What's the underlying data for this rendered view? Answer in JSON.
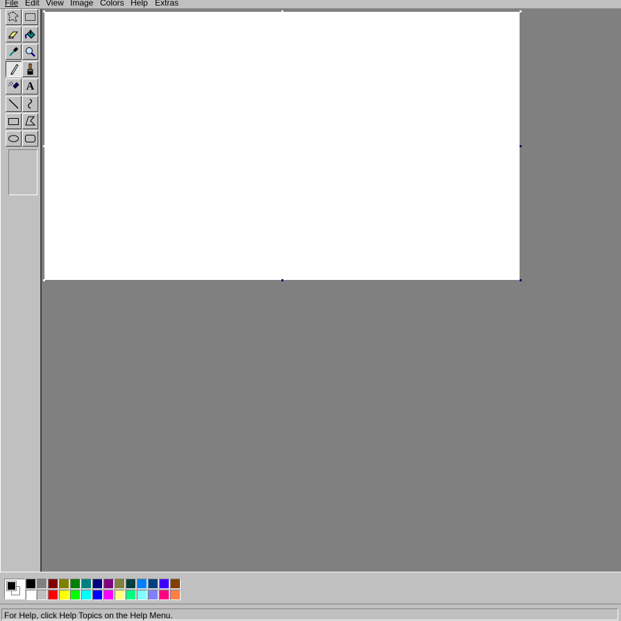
{
  "menu": {
    "items": [
      {
        "label": "File"
      },
      {
        "label": "Edit"
      },
      {
        "label": "View"
      },
      {
        "label": "Image"
      },
      {
        "label": "Colors"
      },
      {
        "label": "Help"
      },
      {
        "label": "Extras"
      }
    ]
  },
  "toolbox": {
    "tools": [
      {
        "icon": "free-form-select-icon"
      },
      {
        "icon": "rect-select-icon"
      },
      {
        "icon": "eraser-icon"
      },
      {
        "icon": "fill-bucket-icon"
      },
      {
        "icon": "color-picker-icon"
      },
      {
        "icon": "magnifier-icon"
      },
      {
        "icon": "pencil-icon",
        "active": true
      },
      {
        "icon": "brush-icon"
      },
      {
        "icon": "airbrush-icon"
      },
      {
        "icon": "text-icon",
        "glyph": "A"
      },
      {
        "icon": "line-icon"
      },
      {
        "icon": "curve-icon"
      },
      {
        "icon": "rectangle-icon"
      },
      {
        "icon": "polygon-icon"
      },
      {
        "icon": "ellipse-icon"
      },
      {
        "icon": "rounded-rectangle-icon"
      }
    ]
  },
  "colors": {
    "foreground": "#000000",
    "background": "#ffffff",
    "palette_top": [
      "#000000",
      "#808080",
      "#800000",
      "#808000",
      "#008000",
      "#008080",
      "#000080",
      "#800080",
      "#808040",
      "#004040",
      "#0080ff",
      "#004080",
      "#4000ff",
      "#804000"
    ],
    "palette_bottom": [
      "#ffffff",
      "#c0c0c0",
      "#ff0000",
      "#ffff00",
      "#00ff00",
      "#00ffff",
      "#0000ff",
      "#ff00ff",
      "#ffff80",
      "#00ff80",
      "#80ffff",
      "#8080ff",
      "#ff0080",
      "#ff8040"
    ]
  },
  "status": {
    "text": "For Help, click Help Topics on the Help Menu."
  }
}
